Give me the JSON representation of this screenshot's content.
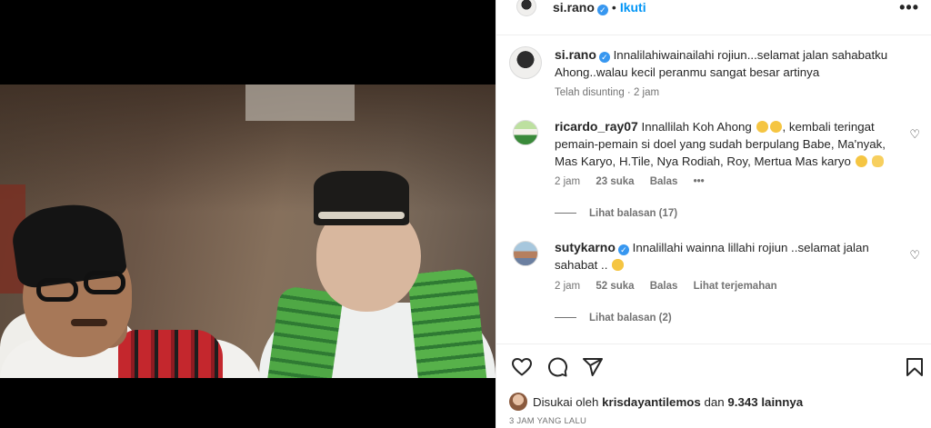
{
  "post": {
    "author": "si.rano",
    "follow_label": "Ikuti",
    "more_label": "•••"
  },
  "caption": {
    "author": "si.rano",
    "text": "Innalilahiwainailahi rojiun...selamat jalan sahabatku Ahong..walau kecil peranmu sangat besar artinya",
    "meta": "Telah disunting · 2 jam"
  },
  "comments": [
    {
      "author": "ricardo_ray07",
      "text_before": "Innallilah Koh Ahong",
      "text_after": ", kembali teringat pemain-pemain si doel yang sudah berpulang Babe, Ma'nyak, Mas Karyo, H.Tile, Nya Rodiah, Roy, Mertua Mas karyo",
      "time": "2 jam",
      "likes": "23 suka",
      "reply": "Balas",
      "more": "•••",
      "view_replies": "Lihat balasan (17)"
    },
    {
      "author": "sutykarno",
      "text": "Innalillahi wainna lillahi rojiun ..selamat jalan sahabat ..",
      "time": "2 jam",
      "likes": "52 suka",
      "reply": "Balas",
      "translate": "Lihat terjemahan",
      "view_replies": "Lihat balasan (2)"
    }
  ],
  "likes_line": {
    "prefix": "Disukai oleh",
    "user": "krisdayantilemos",
    "middle": "dan",
    "count": "9.343 lainnya"
  },
  "timestamp": "3 JAM YANG LALU",
  "icons": [
    "heart-icon",
    "comment-icon",
    "share-icon",
    "bookmark-icon",
    "verified-icon",
    "more-icon"
  ],
  "colors": {
    "link": "#0095f6",
    "verified": "#3797f0",
    "muted": "#737373",
    "text": "#262626"
  }
}
